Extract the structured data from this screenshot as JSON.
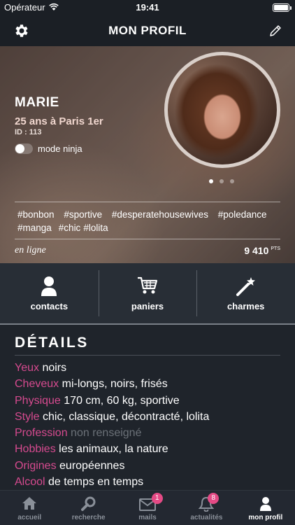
{
  "status_bar": {
    "carrier": "Opérateur",
    "time": "19:41"
  },
  "header": {
    "title": "MON PROFIL",
    "left_icon": "gear-icon",
    "right_icon": "pencil-icon"
  },
  "profile": {
    "name": "MARIE",
    "age_city": "25 ans à Paris 1er",
    "id": "ID : 113",
    "ninja_label": "mode ninja",
    "ninja_on": false,
    "photo_count": 3,
    "photo_index": 0,
    "tags": [
      "#bonbon",
      "#sportive",
      "#desperatehousewives",
      "#poledance",
      "#manga",
      "#chic",
      "#lolita"
    ],
    "status": "en ligne",
    "points": "9 410",
    "points_unit": "PTS"
  },
  "actions": [
    {
      "label": "contacts",
      "icon": "person-icon"
    },
    {
      "label": "paniers",
      "icon": "cart-icon"
    },
    {
      "label": "charmes",
      "icon": "magic-wand-icon"
    }
  ],
  "details": {
    "title": "DÉTAILS",
    "rows": [
      {
        "key": "Yeux",
        "value": "noirs"
      },
      {
        "key": "Cheveux",
        "value": "mi-longs, noirs, frisés"
      },
      {
        "key": "Physique",
        "value": "170 cm, 60 kg, sportive"
      },
      {
        "key": "Style",
        "value": "chic, classique, décontracté, lolita"
      },
      {
        "key": "Profession",
        "value": "non renseigné"
      },
      {
        "key": "Hobbies",
        "value": "les animaux, la nature"
      },
      {
        "key": "Origines",
        "value": "européennes"
      },
      {
        "key": "Alcool",
        "value": "de temps en temps"
      }
    ]
  },
  "tabbar": [
    {
      "label": "accueil",
      "icon": "home-icon"
    },
    {
      "label": "recherche",
      "icon": "search-icon"
    },
    {
      "label": "mails",
      "icon": "mail-icon",
      "badge": "1"
    },
    {
      "label": "actualités",
      "icon": "bell-icon",
      "badge": "8"
    },
    {
      "label": "mon profil",
      "icon": "person-icon",
      "active": true
    }
  ],
  "colors": {
    "accent": "#d64a8f",
    "badge": "#e44a85",
    "background": "#1f242b"
  }
}
